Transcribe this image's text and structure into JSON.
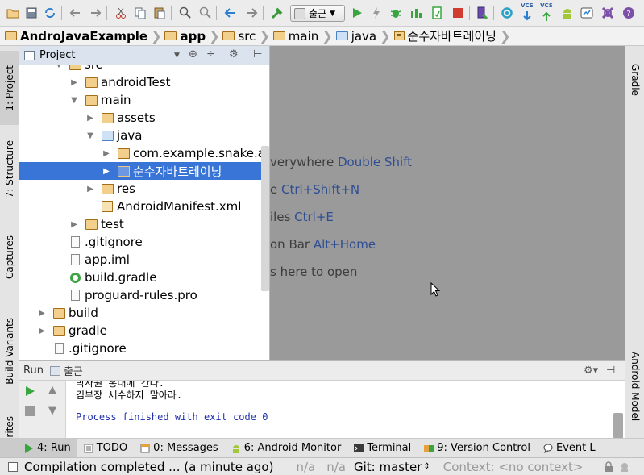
{
  "toolbar": {
    "run_config": "출근",
    "vcs_label_1": "VCS",
    "vcs_label_2": "VCS"
  },
  "breadcrumb": {
    "items": [
      "AndroJavaExample",
      "app",
      "src",
      "main",
      "java",
      "순수자바트레이닝"
    ]
  },
  "left_tabs": {
    "project": "1: Project",
    "structure": "7: Structure",
    "captures": "Captures",
    "build_variants": "Build Variants",
    "favorites": "rites"
  },
  "right_tabs": {
    "gradle": "Gradle",
    "android_model": "Android Model"
  },
  "project_panel": {
    "view_mode": "Project",
    "tree": [
      {
        "label": "src"
      },
      {
        "label": "androidTest"
      },
      {
        "label": "main"
      },
      {
        "label": "assets"
      },
      {
        "label": "java"
      },
      {
        "label": "com.example.snake.ar"
      },
      {
        "label": "순수자바트레이닝"
      },
      {
        "label": "res"
      },
      {
        "label": "AndroidManifest.xml"
      },
      {
        "label": "test"
      },
      {
        "label": ".gitignore"
      },
      {
        "label": "app.iml"
      },
      {
        "label": "build.gradle"
      },
      {
        "label": "proguard-rules.pro"
      },
      {
        "label": "build"
      },
      {
        "label": "gradle"
      },
      {
        "label": ".gitignore"
      }
    ]
  },
  "editor_hints": [
    {
      "text": "verywhere ",
      "key": "Double Shift"
    },
    {
      "text": "e ",
      "key": "Ctrl+Shift+N"
    },
    {
      "text": "iles ",
      "key": "Ctrl+E"
    },
    {
      "text": "on Bar ",
      "key": "Alt+Home"
    },
    {
      "text": "s here to open",
      "key": ""
    }
  ],
  "run_panel": {
    "title": "Run",
    "tab": "출근",
    "console": [
      "박사원 홍대에 간다.",
      "김부장 세수하지 말아라.",
      "",
      "Process finished with exit code 0"
    ]
  },
  "bottom_tabs": [
    {
      "num": "4",
      "label": ": Run"
    },
    {
      "num": "",
      "label": "TODO"
    },
    {
      "num": "0",
      "label": ": Messages"
    },
    {
      "num": "6",
      "label": ": Android Monitor"
    },
    {
      "num": "",
      "label": "Terminal"
    },
    {
      "num": "9",
      "label": ": Version Control"
    },
    {
      "num": "",
      "label": "Event L"
    }
  ],
  "status_bar": {
    "message": "Compilation completed ... (a minute ago)",
    "na1": "n/a",
    "na2": "n/a",
    "git": "Git: master",
    "context": "Context: <no context>"
  }
}
